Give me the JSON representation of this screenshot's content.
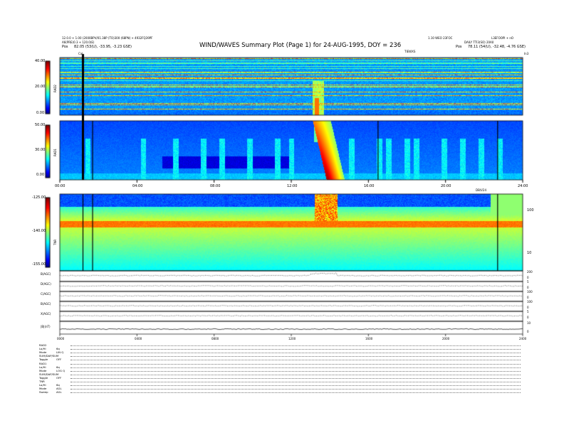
{
  "header": {
    "title": "WIND/WAVES Summary Plot (Page 1) for 24-AUG-1995, DOY = 236",
    "left_line1": "12.0.0 + 1.00 (2000BPV/01.38P (TO)300 (68PN) + 4932FQ39PF",
    "left_line2": "A6(PRE)0.3 + 120.0(E)",
    "left_line3_label": "Pos",
    "left_line3_value": "82.05 (53(U), -33.95, -3.23 GSE)",
    "right_line1": "1.10 WEO 23FOC",
    "right_line2": "L3EFOOPI + nO",
    "right_line3": "DAILY  TTI3(SO) 20A0",
    "right_line4_label": "Pos",
    "right_line4_value": "78.11 (54(U), -32.48, -4.76 GSE)",
    "center_small": "TIEWXS",
    "top_left_marker": "Cal",
    "top_right_marker": "In3"
  },
  "chart_data": [
    {
      "type": "heatmap",
      "panel": "RAD2",
      "ylabel": "RAD2",
      "ytick_labels": [
        "40.00",
        "20.00",
        "0.00"
      ],
      "ylim": [
        0,
        40
      ],
      "colormap": "jet",
      "vertical_markers_hours": [
        2.5
      ]
    },
    {
      "type": "heatmap",
      "panel": "RAD1",
      "ylabel": "RAD1",
      "ytick_labels": [
        "50.00",
        "30.00",
        "0.00"
      ],
      "ylim": [
        0,
        50
      ],
      "colormap": "jet",
      "xtick_labels": [
        "00:00",
        "04:00",
        "08:00",
        "12:00",
        "16:00",
        "20:00",
        "24:00"
      ],
      "xlim_hours": [
        0,
        24
      ],
      "vertical_markers_hours": [
        1.7,
        16.5,
        22.7
      ],
      "event": {
        "start_hour": 13.2,
        "peak_hour": 13.7,
        "end_hour": 14.8
      }
    },
    {
      "type": "heatmap",
      "panel": "TNR",
      "ylabel": "TNR",
      "ytick_labels": [
        "-125.00",
        "-140.00",
        "-155.00"
      ],
      "ylim": [
        -155,
        -125
      ],
      "right_tick_labels": [
        "100",
        "10"
      ],
      "colormap": "jet",
      "sub_label": "DB/V24",
      "vertical_markers_hours": [
        1.7,
        22.7
      ]
    },
    {
      "type": "line",
      "panel": "magnetometer",
      "series": [
        {
          "name": "B(AGC)"
        },
        {
          "name": "D(AGC)"
        },
        {
          "name": "C(AGC)"
        },
        {
          "name": "B(AGC)"
        },
        {
          "name": "X(AGC)"
        },
        {
          "name": "|B|(nT)"
        }
      ],
      "xtick_labels": [
        "0000",
        "0400",
        "0800",
        "1200",
        "1600",
        "2000",
        "2400"
      ],
      "right_ticks": [
        [
          "200",
          "0"
        ],
        [
          "5",
          "0"
        ],
        [
          "100",
          "0"
        ],
        [
          "100",
          "0"
        ],
        [
          "5",
          "0"
        ],
        [
          "10",
          "0"
        ]
      ]
    }
  ],
  "settings": {
    "rows": [
      {
        "label": "RAD2",
        "value": ""
      },
      {
        "label": "Lo/Hi",
        "value": "6q"
      },
      {
        "label": "Mode",
        "value": "LIN Q"
      },
      {
        "label": "SUM/DAP/SUM",
        "value": ""
      },
      {
        "label": "Toggle",
        "value": "OFF"
      },
      {
        "label": "RAD1",
        "value": ""
      },
      {
        "label": "Lo/Hi",
        "value": "6q"
      },
      {
        "label": "Mode",
        "value": "LOG Q"
      },
      {
        "label": "SUM/DAP/SUM",
        "value": ""
      },
      {
        "label": "Toggle",
        "value": "OFF"
      },
      {
        "label": "TNR",
        "value": ""
      },
      {
        "label": "Lo/Hi",
        "value": "6q"
      },
      {
        "label": "Mode",
        "value": "AGL"
      },
      {
        "label": "Sweep",
        "value": "AGL"
      }
    ]
  }
}
